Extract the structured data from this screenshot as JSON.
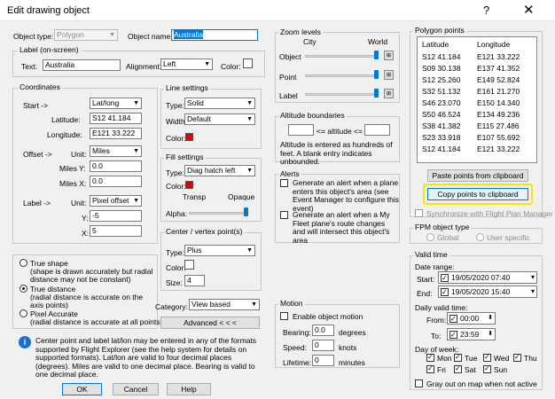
{
  "window": {
    "title": "Edit drawing object",
    "help_icon": "?",
    "close_icon": "✕"
  },
  "object": {
    "type_label": "Object type:",
    "type_value": "Polygon",
    "name_label": "Object name:",
    "name_value": "Australia"
  },
  "label_group": {
    "title": "Label (on-screen)",
    "text_label": "Text:",
    "text_value": "Australia",
    "alignment_label": "Alignment:",
    "alignment_value": "Left",
    "color_label": "Color:"
  },
  "coordinates": {
    "title": "Coordinates",
    "start_label": "Start ->",
    "start_mode": "Lat/long",
    "latitude_label": "Latitude:",
    "latitude_value": "S12 41.184",
    "longitude_label": "Longitude:",
    "longitude_value": "E121 33.222",
    "offset_label": "Offset ->",
    "offset_unit_label": "Unit:",
    "offset_unit": "Miles",
    "miles_y_label": "Miles Y:",
    "miles_y_value": "0.0",
    "miles_x_label": "Miles X:",
    "miles_x_value": "0.0",
    "label_arrow": "Label ->",
    "label_unit_label": "Unit:",
    "label_unit": "Pixel offset",
    "y_label": "Y:",
    "y_value": "-5",
    "x_label": "X:",
    "x_value": "5"
  },
  "shape": {
    "true_shape": "True shape",
    "true_shape_note": "(shape is drawn accurately but radial distance may not be constant)",
    "true_distance": "True distance",
    "true_distance_note": "(radial distance is accurate on the axis points)",
    "pixel_accurate": "Pixel Accurate",
    "pixel_accurate_note": "(radial distance is accurate at all points)"
  },
  "info_text": "Center point and label lat/lon may be entered in any of the formats supported by Flight Explorer (see the help system for details on supported formats). Lat/lon are valid to four decimal places (degrees). Miles are valid to one decimal place. Bearing is valid to one decimal place.",
  "line_settings": {
    "title": "Line settings",
    "type_label": "Type:",
    "type_value": "Solid",
    "width_label": "Width:",
    "width_value": "Default",
    "color_label": "Color:",
    "color": "#e00000"
  },
  "fill_settings": {
    "title": "Fill settings",
    "type_label": "Type:",
    "type_value": "Diag hatch left",
    "color_label": "Color:",
    "color": "#e00000",
    "transp": "Transp",
    "opaque": "Opaque",
    "alpha_label": "Alpha:"
  },
  "center": {
    "title": "Center / vertex point(s)",
    "type_label": "Type:",
    "type_value": "Plus",
    "color_label": "Color:",
    "size_label": "Size:",
    "size_value": "4"
  },
  "category": {
    "label": "Category:",
    "value": "View based"
  },
  "advanced_button": "Advanced  < < <",
  "zoom": {
    "title": "Zoom levels",
    "city": "City",
    "world": "World",
    "object": "Object",
    "point": "Point",
    "label": "Label"
  },
  "altitude": {
    "title": "Altitude boundaries",
    "middle": "<= altitude <=",
    "note": "Altitude is entered as hundreds of feet. A blank entry indicates unbounded."
  },
  "alerts": {
    "title": "Alerts",
    "alert1": "Generate an alert when a plane enters this object's area (see Event Manager to configure this event)",
    "alert2": "Generate an alert when a My Fleet plane's route changes and will intersect this object's area"
  },
  "motion": {
    "title": "Motion",
    "enable": "Enable object motion",
    "bearing_label": "Bearing:",
    "bearing_value": "0.0",
    "bearing_unit": "degrees",
    "speed_label": "Speed:",
    "speed_value": "0",
    "speed_unit": "knots",
    "lifetime_label": "Lifetime:",
    "lifetime_value": "0",
    "lifetime_unit": "minutes"
  },
  "polygon": {
    "title": "Polygon points",
    "col_lat": "Latitude",
    "col_lon": "Longitude",
    "rows": [
      [
        "S12 41.184",
        "E121 33.222"
      ],
      [
        "S09 30.138",
        "E137 41.352"
      ],
      [
        "S12 25.260",
        "E149 52.824"
      ],
      [
        "S32 51.132",
        "E161 21.270"
      ],
      [
        "S46 23.070",
        "E150 14.340"
      ],
      [
        "S50 46.524",
        "E134 49.236"
      ],
      [
        "S38 41.382",
        "E115 27.486"
      ],
      [
        "S23 33.918",
        "E107 55.692"
      ],
      [
        "S12 41.184",
        "E121 33.222"
      ]
    ],
    "paste_button": "Paste points from clipboard",
    "copy_button": "Copy points to clipboard",
    "sync_label": "Synchronize with Flight Plan Manager"
  },
  "fpm": {
    "title": "FPM object type",
    "global": "Global",
    "user": "User specific"
  },
  "valid_time": {
    "title": "Valid time",
    "date_range": "Date range:",
    "start_label": "Start:",
    "start_value": "19/05/2020 07:40",
    "end_label": "End:",
    "end_value": "19/05/2020 15:40",
    "daily": "Daily valid time:",
    "from_label": "From:",
    "from_value": "00:00",
    "to_label": "To:",
    "to_value": "23:59",
    "dow": "Day of week:",
    "mon": "Mon",
    "tue": "Tue",
    "wed": "Wed",
    "thu": "Thu",
    "fri": "Fri",
    "sat": "Sat",
    "sun": "Sun",
    "gray_out": "Gray out on map when not active"
  },
  "buttons": {
    "ok": "OK",
    "cancel": "Cancel",
    "help": "Help"
  },
  "colors": {
    "highlight": "#f4e800",
    "accent": "#0078d7"
  }
}
